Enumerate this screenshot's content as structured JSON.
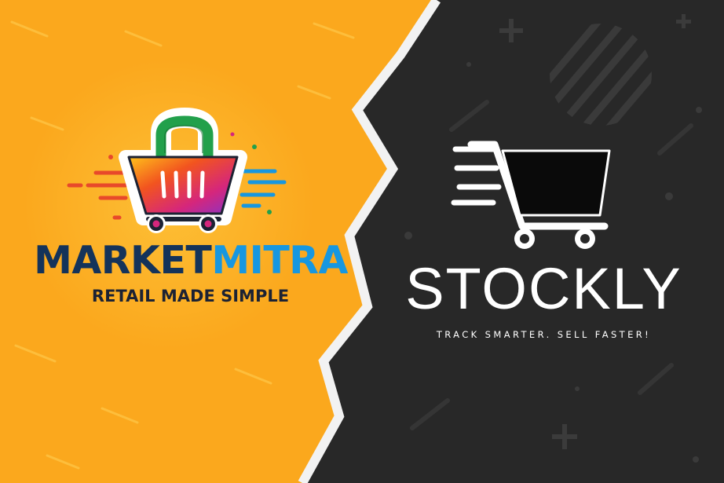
{
  "left_brand": {
    "name_part1": "MARKET",
    "name_part2": "MITRA",
    "tagline": "RETAIL MADE SIMPLE",
    "colors": {
      "background": "#FBA81D",
      "name_dark": "#14335A",
      "name_accent": "#1797E0",
      "tagline": "#1C2233",
      "basket_gradient": [
        "#FFC21B",
        "#F2541F",
        "#D5267C",
        "#8633C8"
      ],
      "handle": "#22A04B"
    },
    "logo_icon": "shopping-basket-icon"
  },
  "right_brand": {
    "name": "STOCKLY",
    "tagline": "TRACK SMARTER. SELL FASTER!",
    "colors": {
      "background": "#282828",
      "text": "#FFFFFF",
      "divider": "#F2F2F2"
    },
    "logo_icon": "shopping-cart-speed-icon"
  }
}
